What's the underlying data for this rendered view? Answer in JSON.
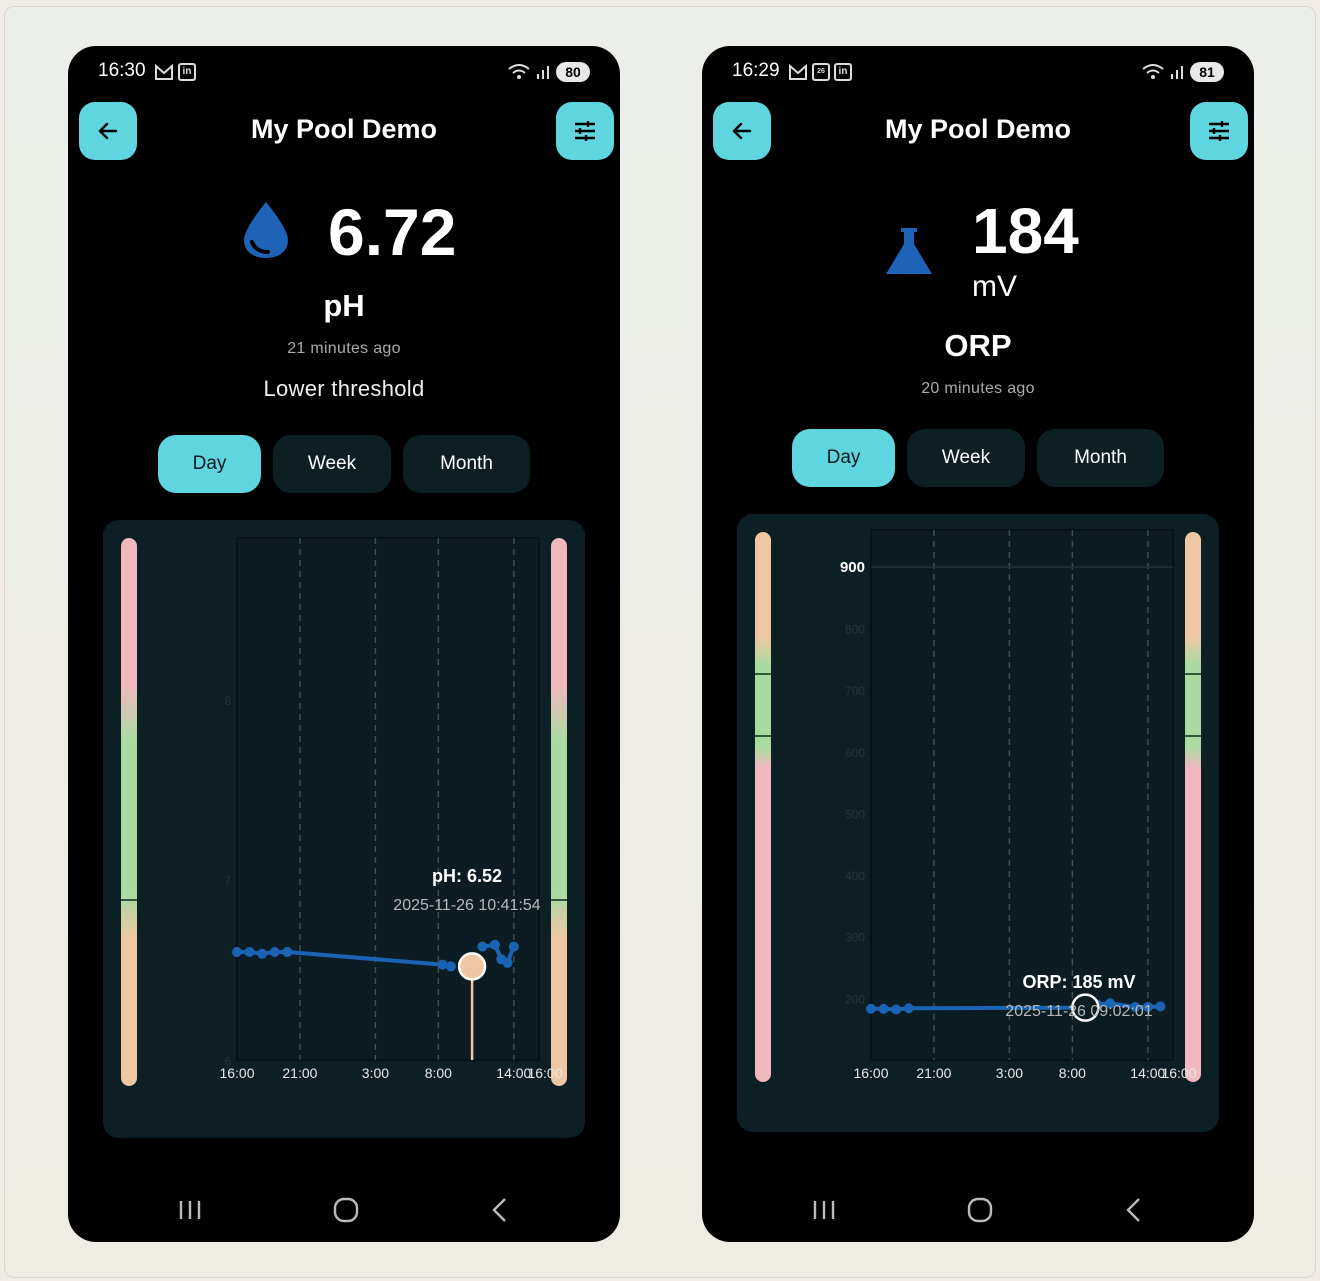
{
  "phones": [
    {
      "status": {
        "time": "16:30",
        "battery": "80"
      },
      "title": "My Pool Demo",
      "metric": {
        "value": "6.72",
        "unit": "",
        "name": "pH",
        "updated": "21 minutes ago",
        "status": "Lower threshold",
        "icon": "water-drop-icon"
      },
      "tabs": [
        "Day",
        "Week",
        "Month"
      ],
      "active_tab": "Day",
      "chart": {
        "x_ticks": [
          "16:00",
          "21:00",
          "3:00",
          "8:00",
          "14:00",
          "16:00"
        ],
        "y_ticks": [
          "6",
          "7",
          "8"
        ],
        "tooltip_title": "pH: 6.52",
        "tooltip_time": "2025-11-26 10:41:54"
      }
    },
    {
      "status": {
        "time": "16:29",
        "battery": "81"
      },
      "title": "My Pool Demo",
      "metric": {
        "value": "184",
        "unit": "mV",
        "name": "ORP",
        "updated": "20 minutes ago",
        "status": "",
        "icon": "flask-icon"
      },
      "tabs": [
        "Day",
        "Week",
        "Month"
      ],
      "active_tab": "Day",
      "chart": {
        "x_ticks": [
          "16:00",
          "21:00",
          "3:00",
          "8:00",
          "14:00",
          "16:00"
        ],
        "y_ticks": [
          "900",
          "800",
          "700",
          "600",
          "500",
          "400",
          "300",
          "200"
        ],
        "tooltip_title": "ORP: 185 mV",
        "tooltip_time": "2025-11-26 09:02:01"
      }
    }
  ],
  "chart_data": [
    {
      "type": "line",
      "title": "",
      "xlabel": "",
      "ylabel": "",
      "x": [
        "16:00",
        "17:00",
        "18:00",
        "19:00",
        "20:00",
        "08:20",
        "09:00",
        "10:41",
        "11:30",
        "12:30",
        "13:00",
        "13:30",
        "14:00"
      ],
      "series": [
        {
          "values": [
            6.6,
            6.6,
            6.59,
            6.6,
            6.6,
            6.53,
            6.52,
            6.52,
            6.63,
            6.64,
            6.56,
            6.54,
            6.63
          ]
        }
      ],
      "x_range": [
        "16:00",
        "16:00"
      ],
      "ylim": [
        6,
        8.9
      ],
      "grid": "vertical dashed",
      "highlighted_point": {
        "x": "10:41",
        "y": 6.52
      },
      "color": "#1b63b5"
    },
    {
      "type": "line",
      "title": "",
      "xlabel": "",
      "ylabel": "",
      "x": [
        "16:00",
        "17:00",
        "18:00",
        "19:00",
        "09:02",
        "10:00",
        "11:00",
        "13:00",
        "14:00",
        "15:00"
      ],
      "series": [
        {
          "values": [
            183,
            183,
            182,
            184,
            185,
            190,
            192,
            186,
            186,
            187
          ]
        }
      ],
      "x_range": [
        "16:00",
        "16:00"
      ],
      "ylim": [
        100,
        960
      ],
      "grid": "vertical dashed",
      "highlighted_point": {
        "x": "09:02",
        "y": 185
      },
      "color": "#1b63b5"
    }
  ],
  "colors": {
    "accent": "#5ed5df",
    "panel": "#0c1f24",
    "line": "#1b63b5",
    "band_red": "#f2b8c0",
    "band_green": "#a9dba0",
    "band_orange": "#f1c6a3"
  }
}
